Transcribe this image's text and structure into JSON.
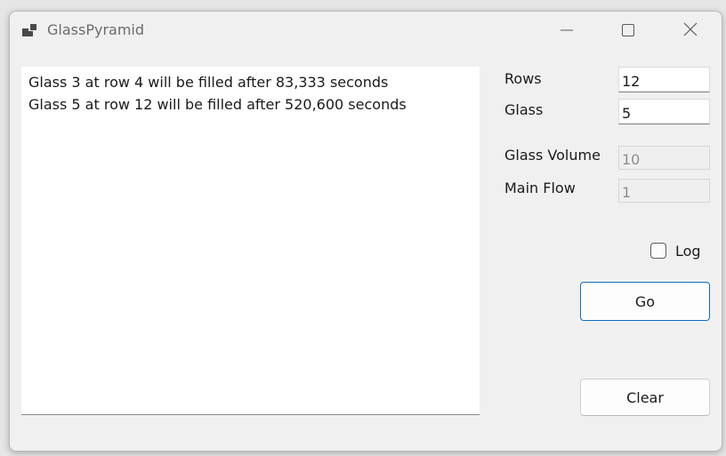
{
  "window": {
    "title": "GlassPyramid"
  },
  "output": {
    "lines": [
      "Glass 3 at row 4 will be filled after 83,333 seconds",
      "Glass 5 at row 12 will be filled after 520,600 seconds"
    ]
  },
  "form": {
    "rows_label": "Rows",
    "rows_value": "12",
    "glass_label": "Glass",
    "glass_value": "5",
    "glass_volume_label": "Glass Volume",
    "glass_volume_value": "10",
    "main_flow_label": "Main Flow",
    "main_flow_value": "1",
    "log_label": "Log",
    "log_checked": false
  },
  "buttons": {
    "go_label": "Go",
    "clear_label": "Clear"
  },
  "icons": {
    "app": "app-windows-icon",
    "minimize": "minimize-icon",
    "maximize": "maximize-icon",
    "close": "close-icon"
  },
  "colors": {
    "accent": "#0f6cbd",
    "window_bg": "#f0f0f0"
  }
}
